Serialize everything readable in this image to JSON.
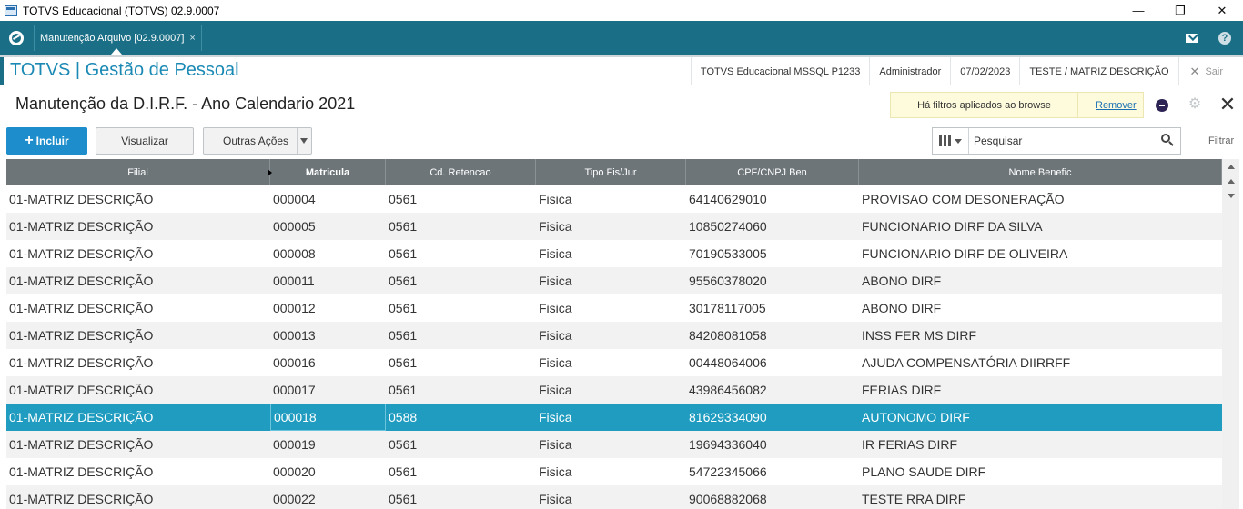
{
  "window": {
    "title": "TOTVS Educacional (TOTVS) 02.9.0007",
    "minimize": "—",
    "maximize": "❐",
    "close": "✕"
  },
  "tabbar": {
    "active_tab": "Manutenção Arquivo [02.9.0007]",
    "tab_close": "×",
    "help": "?"
  },
  "header": {
    "app_title": "TOTVS | Gestão de Pessoal",
    "environment": "TOTVS Educacional MSSQL P1233",
    "user": "Administrador",
    "date": "07/02/2023",
    "branch": "TESTE / MATRIZ DESCRIÇÃO",
    "logout": "Sair",
    "logout_x": "✕"
  },
  "page": {
    "title": "Manutenção da D.I.R.F. - Ano Calendario 2021",
    "filter_message": "Há filtros aplicados ao browse",
    "filter_remove": "Remover"
  },
  "toolbar": {
    "incluir": "Incluir",
    "visualizar": "Visualizar",
    "outras_acoes": "Outras Ações",
    "search_placeholder": "Pesquisar",
    "filtrar": "Filtrar"
  },
  "grid": {
    "columns": [
      "Filial",
      "Matricula",
      "Cd. Retencao",
      "Tipo Fis/Jur",
      "CPF/CNPJ Ben",
      "Nome Benefic"
    ],
    "sorted_column": "Matricula",
    "selected_row": 8,
    "rows": [
      [
        "01-MATRIZ DESCRIÇÃO",
        "000004",
        "0561",
        "Fisica",
        "64140629010",
        "PROVISAO COM DESONERAÇÃO"
      ],
      [
        "01-MATRIZ DESCRIÇÃO",
        "000005",
        "0561",
        "Fisica",
        "10850274060",
        "FUNCIONARIO DIRF DA SILVA"
      ],
      [
        "01-MATRIZ DESCRIÇÃO",
        "000008",
        "0561",
        "Fisica",
        "70190533005",
        "FUNCIONARIO DIRF DE OLIVEIRA"
      ],
      [
        "01-MATRIZ DESCRIÇÃO",
        "000011",
        "0561",
        "Fisica",
        "95560378020",
        "ABONO DIRF"
      ],
      [
        "01-MATRIZ DESCRIÇÃO",
        "000012",
        "0561",
        "Fisica",
        "30178117005",
        "ABONO DIRF"
      ],
      [
        "01-MATRIZ DESCRIÇÃO",
        "000013",
        "0561",
        "Fisica",
        "84208081058",
        "INSS FER MS DIRF"
      ],
      [
        "01-MATRIZ DESCRIÇÃO",
        "000016",
        "0561",
        "Fisica",
        "00448064006",
        "AJUDA COMPENSATÓRIA DIIRRFF"
      ],
      [
        "01-MATRIZ DESCRIÇÃO",
        "000017",
        "0561",
        "Fisica",
        "43986456082",
        "FERIAS DIRF"
      ],
      [
        "01-MATRIZ DESCRIÇÃO",
        "000018",
        "0588",
        "Fisica",
        "81629334090",
        "AUTONOMO DIRF"
      ],
      [
        "01-MATRIZ DESCRIÇÃO",
        "000019",
        "0561",
        "Fisica",
        "19694336040",
        "IR FERIAS DIRF"
      ],
      [
        "01-MATRIZ DESCRIÇÃO",
        "000020",
        "0561",
        "Fisica",
        "54722345066",
        "PLANO SAUDE DIRF"
      ],
      [
        "01-MATRIZ DESCRIÇÃO",
        "000022",
        "0561",
        "Fisica",
        "90068882068",
        "TESTE RRA DIRF"
      ]
    ]
  },
  "colors": {
    "brand_teal": "#1a6f86",
    "title_blue": "#1a89b4",
    "primary_button": "#1d8ecb",
    "selected_row": "#1f9cbf",
    "grid_header": "#6d7579"
  }
}
